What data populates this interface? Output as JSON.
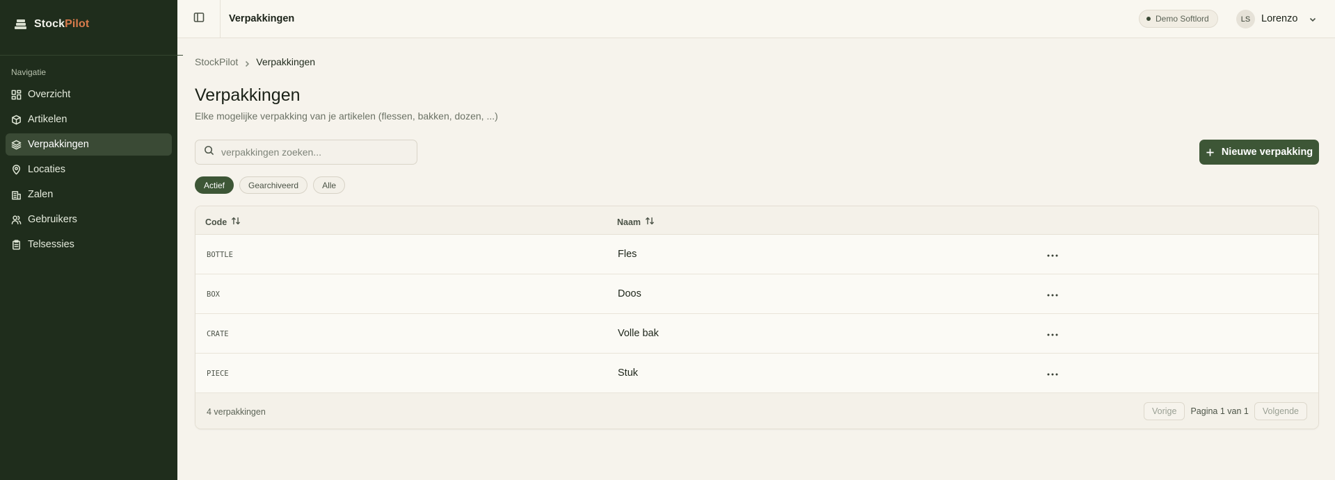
{
  "sidebar": {
    "brand_part1": "Stock",
    "brand_part2": "Pilot",
    "section_label": "Navigatie",
    "items": [
      {
        "label": "Overzicht",
        "icon": "dashboard-icon"
      },
      {
        "label": "Artikelen",
        "icon": "box-icon"
      },
      {
        "label": "Verpakkingen",
        "icon": "layers-icon",
        "active": true
      },
      {
        "label": "Locaties",
        "icon": "map-pin-icon"
      },
      {
        "label": "Zalen",
        "icon": "building-icon"
      },
      {
        "label": "Gebruikers",
        "icon": "users-icon"
      },
      {
        "label": "Telsessies",
        "icon": "clipboard-icon"
      }
    ]
  },
  "topbar": {
    "title": "Verpakkingen",
    "demo_badge": "Demo Softlord",
    "user_initials": "LS",
    "user_name": "Lorenzo"
  },
  "breadcrumb": {
    "root": "StockPilot",
    "current": "Verpakkingen"
  },
  "page": {
    "title": "Verpakkingen",
    "subtitle": "Elke mogelijke verpakking van je artikelen (flessen, bakken, dozen, ...)"
  },
  "search": {
    "placeholder": "verpakkingen zoeken...",
    "value": ""
  },
  "actions": {
    "new_label": "Nieuwe verpakking"
  },
  "filters": [
    {
      "label": "Actief",
      "active": true
    },
    {
      "label": "Gearchiveerd",
      "active": false
    },
    {
      "label": "Alle",
      "active": false
    }
  ],
  "table": {
    "columns": [
      "Code",
      "Naam"
    ],
    "rows": [
      {
        "code": "BOTTLE",
        "name": "Fles"
      },
      {
        "code": "BOX",
        "name": "Doos"
      },
      {
        "code": "CRATE",
        "name": "Volle bak"
      },
      {
        "code": "PIECE",
        "name": "Stuk"
      }
    ],
    "count_label": "4 verpakkingen",
    "prev_label": "Vorige",
    "page_label": "Pagina 1 van 1",
    "next_label": "Volgende"
  },
  "colors": {
    "sidebar_bg": "#1f2d1c",
    "accent": "#3d5636",
    "brand_accent": "#d97b4c"
  }
}
